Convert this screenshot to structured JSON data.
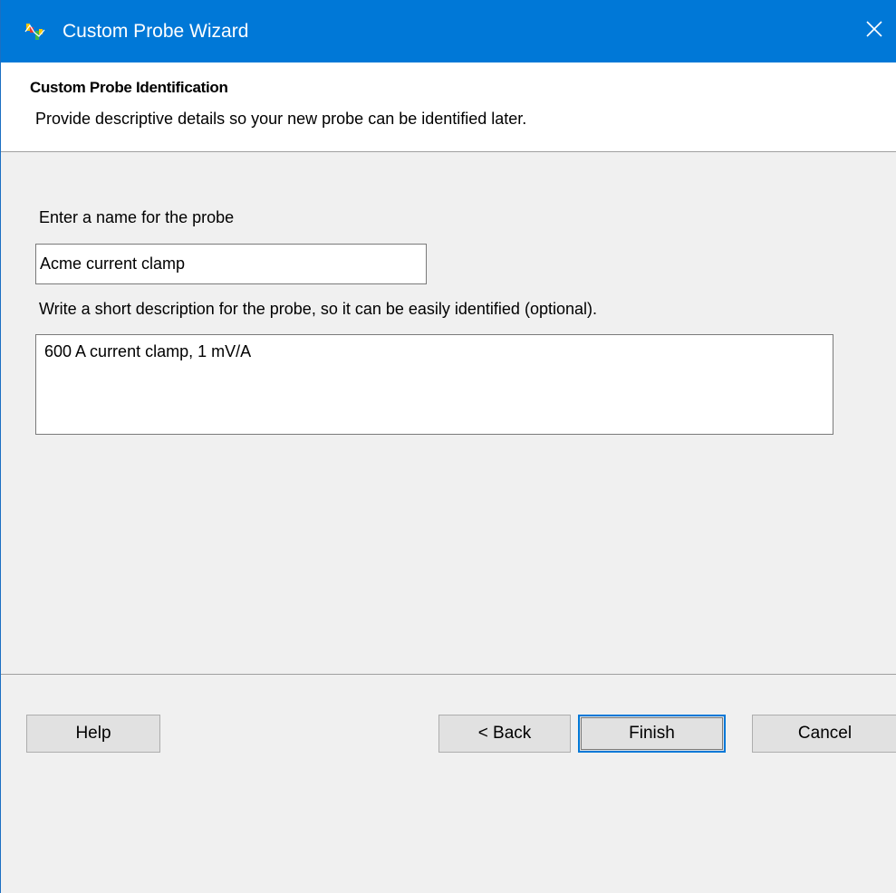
{
  "window": {
    "title": "Custom Probe Wizard",
    "close_icon": "close-icon",
    "app_icon": "picoscope-probe-icon",
    "accent_color": "#0078d7"
  },
  "header": {
    "title": "Custom Probe Identification",
    "subtitle": "Provide descriptive details so your new probe can be identified later."
  },
  "form": {
    "name_label": "Enter a name for the probe",
    "name_value": "Acme current clamp",
    "description_label": "Write a short description for the probe, so it can be easily identified (optional).",
    "description_value": "600 A current clamp, 1 mV/A"
  },
  "buttons": {
    "help": "Help",
    "back": "< Back",
    "finish": "Finish",
    "cancel": "Cancel"
  }
}
